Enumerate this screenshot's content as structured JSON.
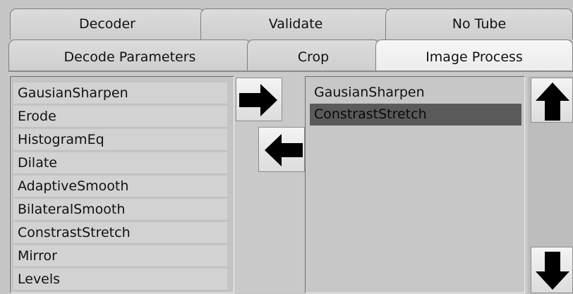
{
  "tabs_row1": [
    {
      "label": "Decoder"
    },
    {
      "label": "Validate"
    },
    {
      "label": "No Tube"
    }
  ],
  "tabs_row2": [
    {
      "label": "Decode Parameters"
    },
    {
      "label": "Crop"
    },
    {
      "label": "Image Process",
      "active": true
    }
  ],
  "available_filters": [
    "GausianSharpen",
    "Erode",
    "HistogramEq",
    "Dilate",
    "AdaptiveSmooth",
    "BilateralSmooth",
    "ConstrastStretch",
    "Mirror",
    "Levels"
  ],
  "selected_filters": [
    {
      "label": "GausianSharpen",
      "selected": false
    },
    {
      "label": "ConstrastStretch",
      "selected": true
    }
  ],
  "icons": {
    "add": "arrow-right-icon",
    "remove": "arrow-left-icon",
    "move_up": "arrow-up-icon",
    "move_down": "arrow-down-icon"
  },
  "colors": {
    "selection": "#5b5b5b",
    "panel": "#c9c9c9"
  }
}
